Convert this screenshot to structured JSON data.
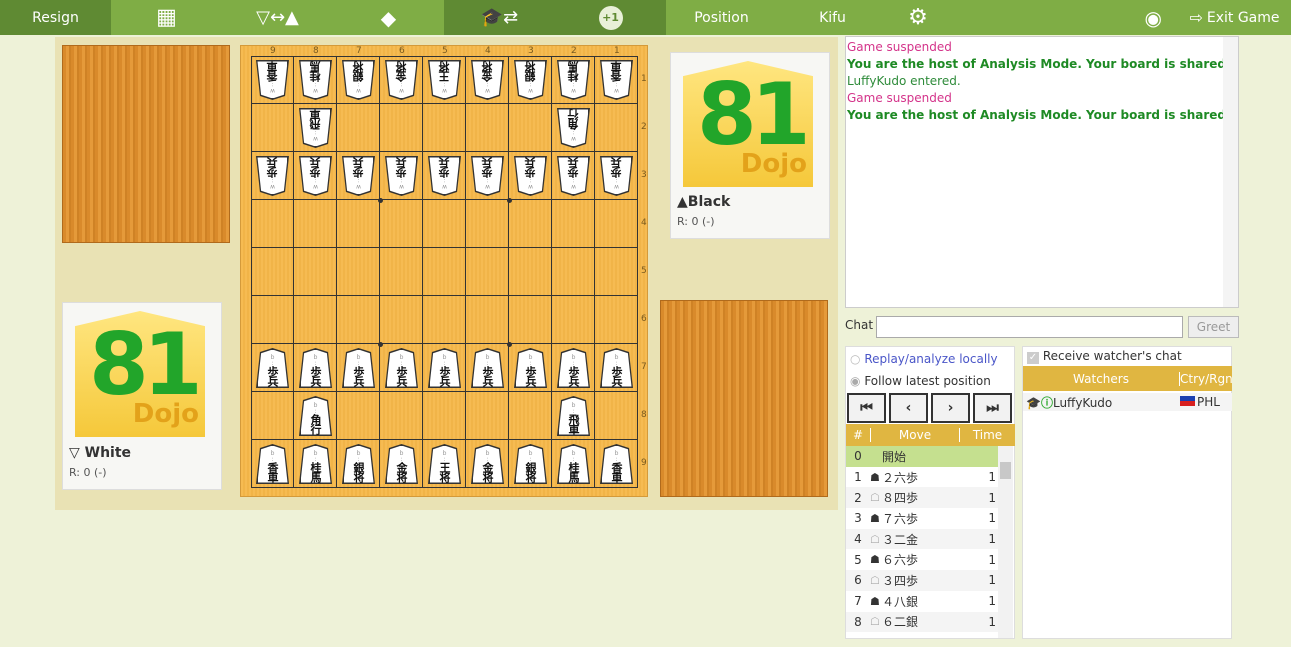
{
  "topbar": {
    "resign": "Resign",
    "position": "Position",
    "kifu": "Kifu",
    "exit": "Exit Game",
    "plus_one": "+1",
    "icons": [
      "calculator-icon",
      "swap-sides-icon",
      "eraser-icon",
      "analysis-mode-icon",
      "plus-one-icon",
      "gear-icon",
      "eye-icon",
      "exit-icon"
    ]
  },
  "players": {
    "white": {
      "name": "White",
      "rating": "R: 0 (-)"
    },
    "black": {
      "name": "Black",
      "rating": "R: 0 (-)"
    },
    "logo_text": "81 Dojo"
  },
  "board": {
    "files": [
      "9",
      "8",
      "7",
      "6",
      "5",
      "4",
      "3",
      "2",
      "1"
    ],
    "ranks": [
      "1",
      "2",
      "3",
      "4",
      "5",
      "6",
      "7",
      "8",
      "9"
    ],
    "rows": [
      [
        "w:香車",
        "w:桂馬",
        "w:銀将",
        "w:金将",
        "w:王将",
        "w:金将",
        "w:銀将",
        "w:桂馬",
        "w:香車"
      ],
      [
        "",
        "w:飛車",
        "",
        "",
        "",
        "",
        "",
        "w:角行",
        ""
      ],
      [
        "w:歩兵",
        "w:歩兵",
        "w:歩兵",
        "w:歩兵",
        "w:歩兵",
        "w:歩兵",
        "w:歩兵",
        "w:歩兵",
        "w:歩兵"
      ],
      [
        "",
        "",
        "",
        "",
        "",
        "",
        "",
        "",
        ""
      ],
      [
        "",
        "",
        "",
        "",
        "",
        "",
        "",
        "",
        ""
      ],
      [
        "",
        "",
        "",
        "",
        "",
        "",
        "",
        "",
        ""
      ],
      [
        "b:歩兵",
        "b:歩兵",
        "b:歩兵",
        "b:歩兵",
        "b:歩兵",
        "b:歩兵",
        "b:歩兵",
        "b:歩兵",
        "b:歩兵"
      ],
      [
        "",
        "b:角行",
        "",
        "",
        "",
        "",
        "",
        "b:飛車",
        ""
      ],
      [
        "b:香車",
        "b:桂馬",
        "b:銀将",
        "b:金将",
        "b:王将",
        "b:金将",
        "b:銀将",
        "b:桂馬",
        "b:香車"
      ]
    ]
  },
  "chat": {
    "messages": [
      {
        "text": "Game suspended",
        "style": "pink"
      },
      {
        "text": "You are the host of Analysis Mode. Your board is shared.",
        "style": "gb"
      },
      {
        "text": "LuffyKudo entered.",
        "style": "g"
      },
      {
        "text": "Game suspended",
        "style": "pink"
      },
      {
        "text": "You are the host of Analysis Mode. Your board is shared.",
        "style": "gb"
      }
    ],
    "label": "Chat",
    "input_value": "",
    "greet": "Greet"
  },
  "replay": {
    "local": "Replay/analyze locally",
    "follow": "Follow latest position",
    "selected": "follow"
  },
  "moves": {
    "headers": [
      "#",
      "Move",
      "Time"
    ],
    "rows": [
      {
        "n": "0",
        "side": "",
        "move": "開始",
        "time": ""
      },
      {
        "n": "1",
        "side": "b",
        "move": "２六歩",
        "time": "1"
      },
      {
        "n": "2",
        "side": "w",
        "move": "８四歩",
        "time": "1"
      },
      {
        "n": "3",
        "side": "b",
        "move": "７六歩",
        "time": "1"
      },
      {
        "n": "4",
        "side": "w",
        "move": "３二金",
        "time": "1"
      },
      {
        "n": "5",
        "side": "b",
        "move": "６六歩",
        "time": "1"
      },
      {
        "n": "6",
        "side": "w",
        "move": "３四歩",
        "time": "1"
      },
      {
        "n": "7",
        "side": "b",
        "move": "４八銀",
        "time": "1"
      },
      {
        "n": "8",
        "side": "w",
        "move": "６二銀",
        "time": "1"
      }
    ]
  },
  "watchers": {
    "receive_chat": "Receive watcher's chat",
    "receive_checked": true,
    "headers": [
      "Watchers",
      "Ctry/Rgn"
    ],
    "list": [
      {
        "name": "LuffyKudo",
        "country": "PHL"
      }
    ]
  }
}
